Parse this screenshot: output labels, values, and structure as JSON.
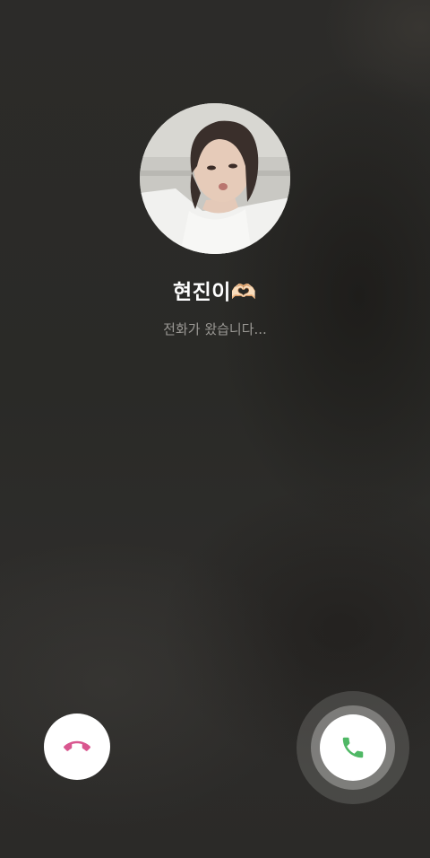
{
  "call": {
    "caller_name": "현진이🫶🏻",
    "status": "전화가 왔습니다..."
  },
  "actions": {
    "decline_icon": "phone-hangup-icon",
    "accept_icon": "phone-icon"
  },
  "colors": {
    "decline": "#d9568f",
    "accept": "#4fb865",
    "background": "#2a2a28"
  }
}
